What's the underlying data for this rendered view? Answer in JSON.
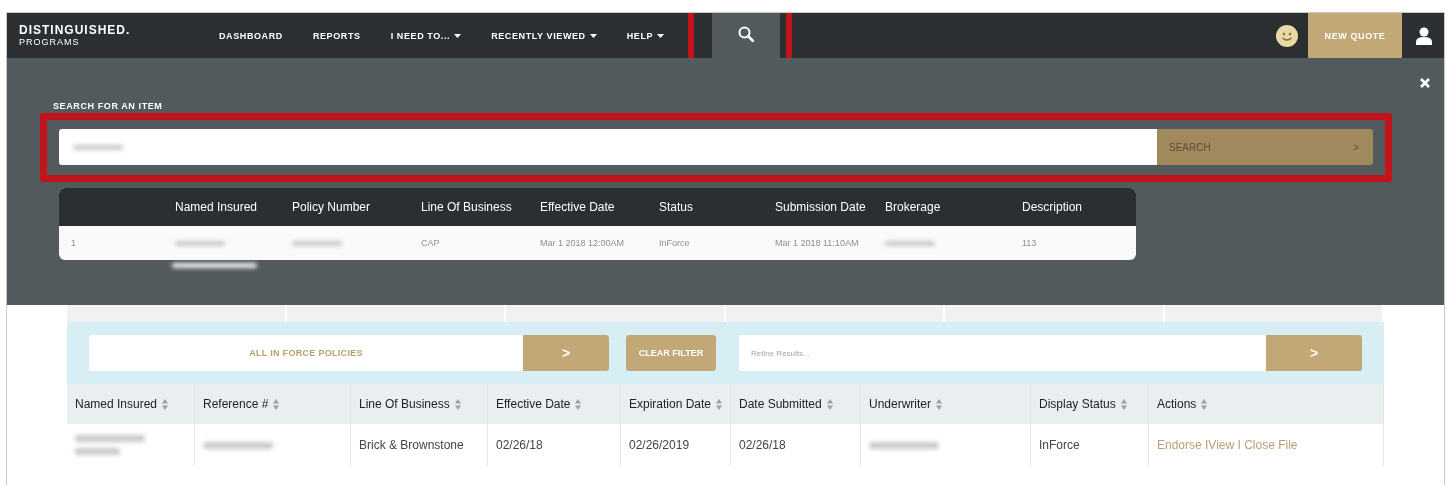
{
  "brand": {
    "name": "DISTINGUISHED.",
    "sub": "PROGRAMS"
  },
  "nav": [
    {
      "label": "DASHBOARD",
      "dropdown": false,
      "selected": false
    },
    {
      "label": "REPORTS",
      "dropdown": false,
      "selected": false
    },
    {
      "label": "I NEED TO...",
      "dropdown": true,
      "selected": false
    },
    {
      "label": "RECENTLY VIEWED",
      "dropdown": true,
      "selected": false
    },
    {
      "label": "HELP",
      "dropdown": true,
      "selected": false
    }
  ],
  "search_tab": {
    "selected": true
  },
  "new_quote": "NEW QUOTE",
  "search_panel": {
    "heading": "SEARCH FOR AN ITEM",
    "button": "SEARCH",
    "arrow": ">",
    "results": {
      "columns": [
        "",
        "Named Insured",
        "Policy Number",
        "Line Of Business",
        "Effective Date",
        "Status",
        "Submission Date",
        "Brokerage",
        "Description"
      ],
      "rows": [
        [
          "1",
          null,
          null,
          "CAP",
          "Mar 1 2018 12:00AM",
          "InForce",
          "Mar 1 2018 11:10AM",
          null,
          "113"
        ]
      ]
    }
  },
  "filter": {
    "select": "ALL IN FORCE POLICIES",
    "select_arrow": ">",
    "clear": "CLEAR FILTER",
    "refine_placeholder": "Refine Results...",
    "refine_arrow": ">"
  },
  "table": {
    "columns": [
      "Named Insured",
      "Reference #",
      "Line Of Business",
      "Effective Date",
      "Expiration Date",
      "Date Submitted",
      "Underwriter",
      "Display Status",
      "Actions"
    ],
    "rows": [
      [
        null,
        null,
        "Brick & Brownstone",
        "02/26/18",
        "02/26/2019",
        "02/26/18",
        null,
        "InForce",
        "Endorse IView I Close File"
      ]
    ]
  }
}
